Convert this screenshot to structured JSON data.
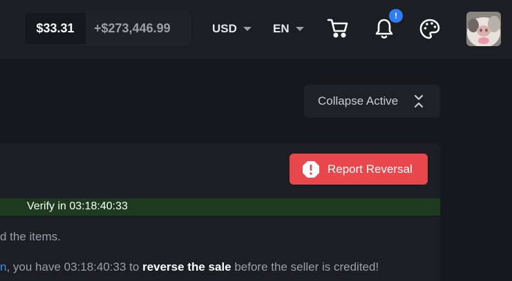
{
  "header": {
    "balance": "$33.31",
    "pending_balance": "+$273,446.99",
    "currency": "USD",
    "language": "EN",
    "notification_badge": "!",
    "icons": [
      "cart-icon",
      "bell-icon",
      "palette-icon",
      "avatar"
    ]
  },
  "toolbar": {
    "collapse_label": "Collapse Active"
  },
  "trade": {
    "report_label": "Report Reversal",
    "verify_text": "Verify in 03:18:40:33",
    "line1": "d the items.",
    "line2_prefix": "n",
    "line2_mid": ", you have 03:18:40:33 to ",
    "line2_strong": "reverse the sale",
    "line2_suffix": " before the seller is credited!"
  },
  "colors": {
    "background": "#16181d",
    "panel": "#1c1e24",
    "report": "#e8474c",
    "verify": "#1d3a1f",
    "badge": "#2f7df6"
  }
}
